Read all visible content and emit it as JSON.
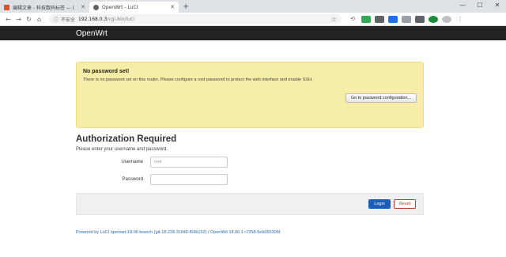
{
  "browser": {
    "tabs": [
      {
        "title": "编辑文章 - 科技数码标签 — (",
        "fav_color": "#e44d26"
      },
      {
        "title": "OpenWrt - LuCI",
        "fav_color": "#5f6368"
      }
    ],
    "address": {
      "insecure_label": "不安全",
      "host": "192.168.0.3",
      "path": "/cgi-bin/luci"
    }
  },
  "header": {
    "brand": "OpenWrt"
  },
  "alert": {
    "title": "No password set!",
    "message": "There is no password set on this router. Please configure a root password to protect the web interface and enable SSH.",
    "button": "Go to password configuration..."
  },
  "login": {
    "heading": "Authorization Required",
    "hint": "Please enter your username and password.",
    "username_label": "Username",
    "username_value": "root",
    "password_label": "Password",
    "login_button": "Login",
    "reset_button": "Reset"
  },
  "footer": {
    "link": "Powered by LuCI openwrt-18.06 branch (git-18.228.31946-f64b152)",
    "separator": " / ",
    "version": "OpenWrt 18.06.1 r7258-5eb055306f"
  }
}
